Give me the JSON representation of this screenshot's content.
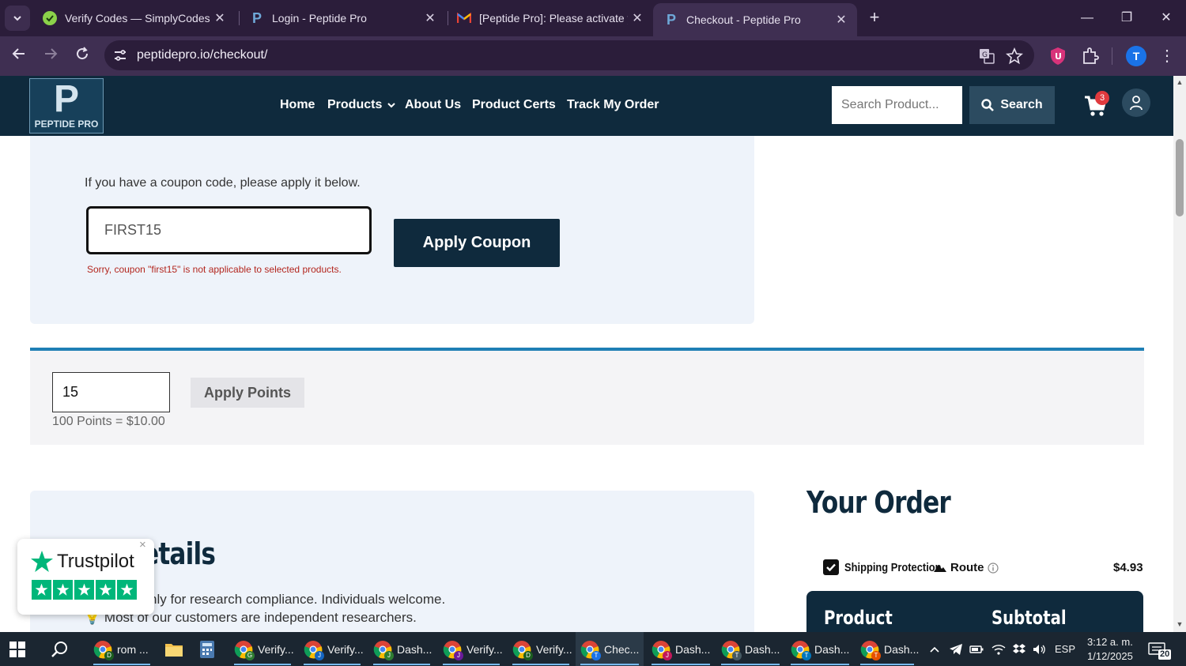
{
  "browser": {
    "tabs": [
      {
        "title": "Verify Codes — SimplyCodes",
        "favicon": "simplycodes-icon"
      },
      {
        "title": "Login - Peptide Pro",
        "favicon": "peptide-p-icon"
      },
      {
        "title": "[Peptide Pro]: Please activate yo",
        "favicon": "gmail-icon"
      },
      {
        "title": "Checkout - Peptide Pro",
        "favicon": "peptide-p-icon"
      }
    ],
    "url": "peptidepro.io/checkout/",
    "profile_initial": "T"
  },
  "site": {
    "logo_letter": "P",
    "logo_text": "PEPTIDE PRO",
    "nav": [
      "Home",
      "Products",
      "About Us",
      "Product Certs",
      "Track My Order"
    ],
    "search_placeholder": "Search Product...",
    "search_button": "Search",
    "cart_count": "3"
  },
  "coupon": {
    "intro": "If you have a coupon code, please apply it below.",
    "value": "FIRST15",
    "error": "Sorry, coupon \"first15\" is not applicable to selected products.",
    "button": "Apply Coupon"
  },
  "points": {
    "value": "15",
    "button": "Apply Points",
    "note": "100 Points = $10.00"
  },
  "details": {
    "title_visible": "Details",
    "line1_visible": "used only for research compliance. Individuals welcome.",
    "line2_visible": "Most of our customers are independent researchers."
  },
  "order": {
    "title": "Your Order",
    "shipping_label": "Shipping Protection",
    "route_label": "Route",
    "shipping_price": "$4.93",
    "col_product": "Product",
    "col_subtotal": "Subtotal"
  },
  "trustpilot": {
    "brand": "Trustpilot",
    "close": "×"
  },
  "taskbar": {
    "items": [
      {
        "label": "rom ...",
        "badge": "D"
      },
      {
        "label": "",
        "badge": ""
      },
      {
        "label": "",
        "badge": ""
      },
      {
        "label": "Verify...",
        "badge": "G"
      },
      {
        "label": "Verify...",
        "badge": "J"
      },
      {
        "label": "Dash...",
        "badge": "J"
      },
      {
        "label": "Verify...",
        "badge": "J"
      },
      {
        "label": "Verify...",
        "badge": "D"
      },
      {
        "label": "Chec...",
        "badge": "T"
      },
      {
        "label": "Dash...",
        "badge": "J"
      },
      {
        "label": "Dash...",
        "badge": "T"
      },
      {
        "label": "Dash...",
        "badge": "T"
      },
      {
        "label": "Dash...",
        "badge": "T"
      }
    ],
    "language": "ESP",
    "time": "3:12 a. m.",
    "date": "1/12/2025",
    "notifications": "20"
  },
  "colors": {
    "header_navy": "#0f2a3d",
    "accent_blue": "#1f7fb5",
    "error_red": "#b3261e",
    "trustpilot_green": "#00b67a"
  }
}
